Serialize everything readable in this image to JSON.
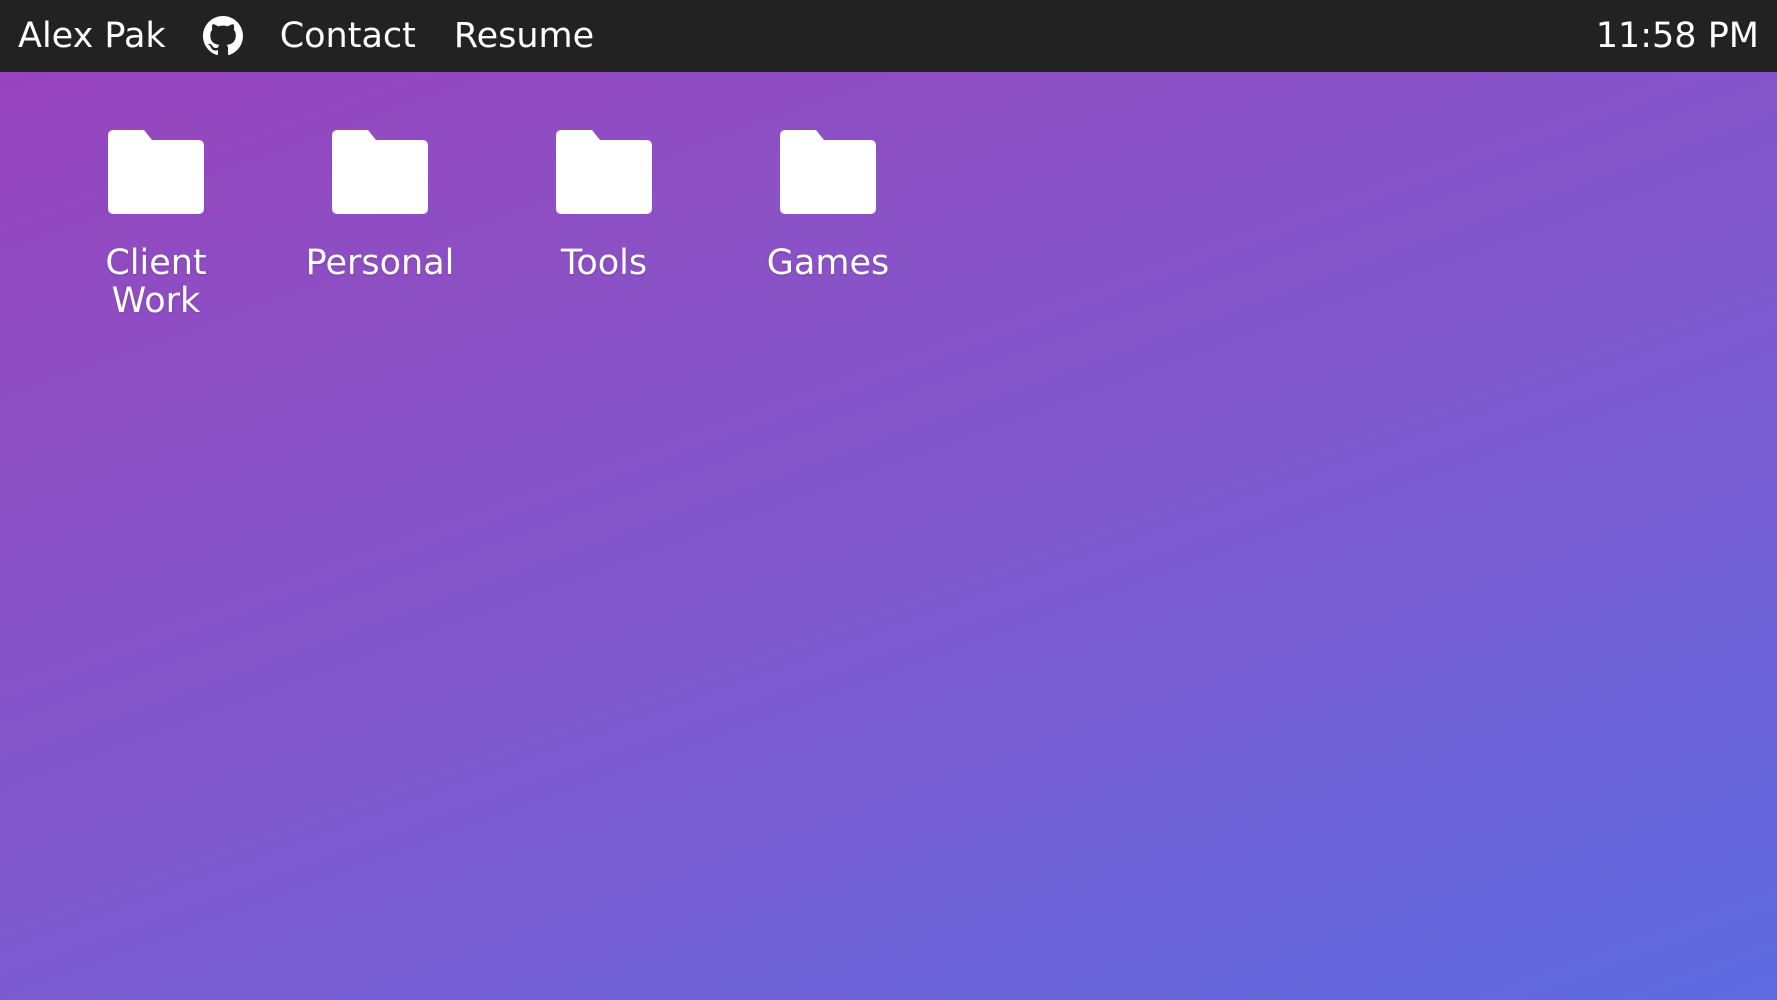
{
  "menubar": {
    "name": "Alex Pak",
    "github_icon": "github-icon",
    "links": [
      "Contact",
      "Resume"
    ],
    "clock": "11:58 PM"
  },
  "desktop": {
    "folders": [
      {
        "label": "Client Work",
        "icon": "folder-icon"
      },
      {
        "label": "Personal",
        "icon": "folder-icon"
      },
      {
        "label": "Tools",
        "icon": "folder-icon"
      },
      {
        "label": "Games",
        "icon": "folder-icon"
      }
    ]
  },
  "colors": {
    "menubar_bg": "#222222",
    "gradient_start": "#9744bd",
    "gradient_end": "#5d6ae0",
    "text": "#ffffff"
  }
}
